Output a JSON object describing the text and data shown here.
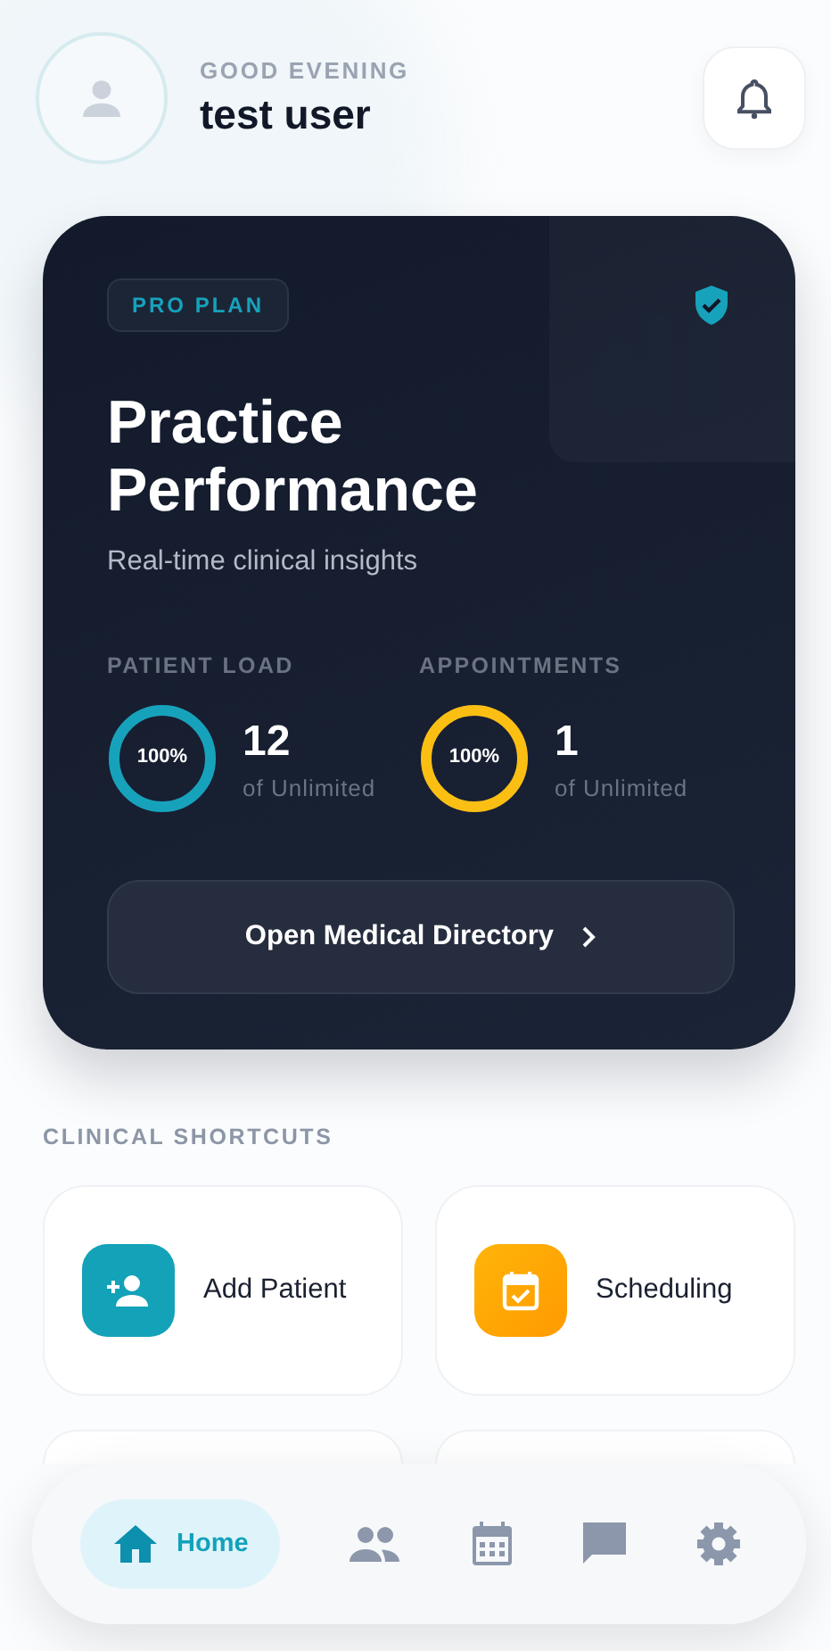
{
  "header": {
    "greeting": "GOOD EVENING",
    "user_name": "test user"
  },
  "plan_card": {
    "badge": "PRO PLAN",
    "title": "Practice Performance",
    "subtitle": "Real-time clinical insights",
    "stats": [
      {
        "label": "PATIENT LOAD",
        "level": 1,
        "percent": "100%",
        "value": "12",
        "limit": "of Unlimited",
        "color": "#17a2bb"
      },
      {
        "label": "APPOINTMENTS",
        "level": 1,
        "percent": "100%",
        "value": "1",
        "limit": "of Unlimited",
        "color": "#fbbf13"
      }
    ],
    "button": "Open Medical Directory"
  },
  "shortcuts": {
    "title": "CLINICAL SHORTCUTS",
    "items": [
      {
        "kind": "add-patient",
        "label": "Add Patient"
      },
      {
        "kind": "scheduling",
        "label": "Scheduling"
      }
    ]
  },
  "nav": [
    {
      "kind": "home",
      "label": "Home",
      "selected": true
    },
    {
      "kind": "people",
      "selected": false
    },
    {
      "kind": "calendar",
      "selected": false
    },
    {
      "kind": "chat",
      "selected": false
    },
    {
      "kind": "settings",
      "selected": false
    }
  ]
}
